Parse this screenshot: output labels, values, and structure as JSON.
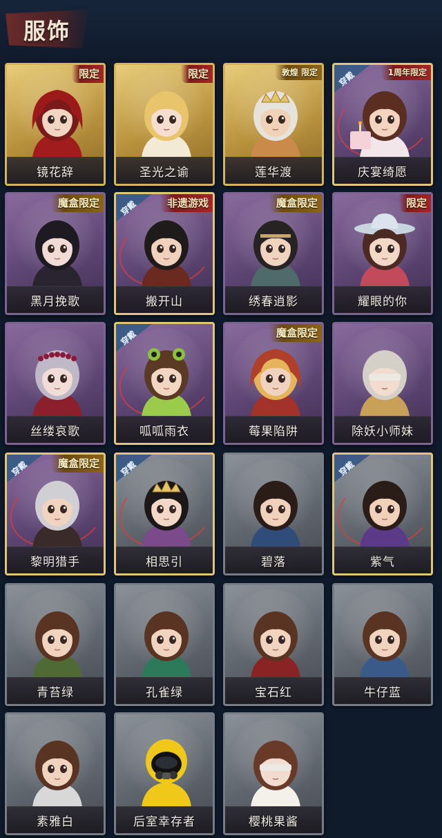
{
  "header": {
    "title": "服饰"
  },
  "costumes": [
    {
      "name": "镜花辞",
      "tag": "限定",
      "tag_style": "red",
      "frame": "gold",
      "worn": false,
      "hair": "#7a1a1a",
      "outfit": "#a11d1d",
      "skin": "#f2d6c4",
      "hat": "hood"
    },
    {
      "name": "圣光之谕",
      "tag": "限定",
      "tag_style": "red",
      "frame": "gold",
      "worn": false,
      "hair": "#e8c56a",
      "outfit": "#f3ead6",
      "skin": "#f5ddd0",
      "hat": "none"
    },
    {
      "name": "莲华渡",
      "tag": "敦煌 限定",
      "tag_style": "box",
      "frame": "gold",
      "worn": false,
      "hair": "#e6e2dc",
      "outfit": "#c98a4a",
      "skin": "#f0d2b8",
      "hat": "crown"
    },
    {
      "name": "庆宴绮愿",
      "tag": "1周年限定",
      "tag_style": "red",
      "frame": "purple",
      "worn": true,
      "hair": "#5a2f22",
      "outfit": "#f2e6ea",
      "skin": "#f2d4c0",
      "hat": "cake"
    },
    {
      "name": "黑月挽歌",
      "tag": "魔盒限定",
      "tag_style": "box",
      "frame": "purple",
      "worn": false,
      "hair": "#1e1a22",
      "outfit": "#2a2330",
      "skin": "#f0dcd4",
      "hat": "none"
    },
    {
      "name": "搬开山",
      "tag": "非遗游戏",
      "tag_style": "red",
      "frame": "purple",
      "worn": true,
      "hair": "#1f1b1b",
      "outfit": "#6a2a20",
      "skin": "#f0d2bc",
      "hat": "none"
    },
    {
      "name": "绣春逍影",
      "tag": "魔盒限定",
      "tag_style": "box",
      "frame": "purple",
      "worn": false,
      "hair": "#262322",
      "outfit": "#4f6a6a",
      "skin": "#efd4c0",
      "hat": "band"
    },
    {
      "name": "耀眼的你",
      "tag": "限定",
      "tag_style": "red",
      "frame": "purple",
      "worn": false,
      "hair": "#4a2a22",
      "outfit": "#c24a5a",
      "skin": "#f3d8c8",
      "hat": "cowboy"
    },
    {
      "name": "丝缕哀歌",
      "tag": "",
      "tag_style": "",
      "frame": "purple",
      "worn": false,
      "hair": "#bfb8c6",
      "outfit": "#8c1f2c",
      "skin": "#f2dcd8",
      "hat": "roses"
    },
    {
      "name": "呱呱雨衣",
      "tag": "",
      "tag_style": "",
      "frame": "purple",
      "worn": true,
      "hair": "#5a3a24",
      "outfit": "#9acb4a",
      "skin": "#f1d6c2",
      "hat": "frog"
    },
    {
      "name": "莓果陷阱",
      "tag": "魔盒限定",
      "tag_style": "box",
      "frame": "purple",
      "worn": false,
      "hair": "#e6b45a",
      "outfit": "#a2322a",
      "skin": "#f0d2c0",
      "hat": "hood-red"
    },
    {
      "name": "除妖小师妹",
      "tag": "",
      "tag_style": "",
      "frame": "purple",
      "worn": false,
      "hair": "#d4d0c8",
      "outfit": "#c8a058",
      "skin": "#f2dcd0",
      "hat": "blindfold"
    },
    {
      "name": "黎明猎手",
      "tag": "魔盒限定",
      "tag_style": "box",
      "frame": "purple",
      "worn": true,
      "hair": "#cfcfd4",
      "outfit": "#3a2a2a",
      "skin": "#f0d4c0",
      "hat": "none"
    },
    {
      "name": "相思引",
      "tag": "",
      "tag_style": "",
      "frame": "gray",
      "worn": true,
      "hair": "#1c1818",
      "outfit": "#7a4a8a",
      "skin": "#f2d8c6",
      "hat": "crown"
    },
    {
      "name": "碧落",
      "tag": "",
      "tag_style": "",
      "frame": "gray",
      "worn": false,
      "hair": "#2a1d18",
      "outfit": "#2f4c7a",
      "skin": "#f0d2bc",
      "hat": "none"
    },
    {
      "name": "紫气",
      "tag": "",
      "tag_style": "",
      "frame": "gray",
      "worn": true,
      "hair": "#2a1d18",
      "outfit": "#5b3a8a",
      "skin": "#f0d2bc",
      "hat": "none"
    },
    {
      "name": "青苔绿",
      "tag": "",
      "tag_style": "",
      "frame": "gray",
      "worn": false,
      "hair": "#5a3422",
      "outfit": "#4f6a34",
      "skin": "#f1d4c0",
      "hat": "none"
    },
    {
      "name": "孔雀绿",
      "tag": "",
      "tag_style": "",
      "frame": "gray",
      "worn": false,
      "hair": "#5a3422",
      "outfit": "#2d7a5a",
      "skin": "#f1d4c0",
      "hat": "none"
    },
    {
      "name": "宝石红",
      "tag": "",
      "tag_style": "",
      "frame": "gray",
      "worn": false,
      "hair": "#5a3422",
      "outfit": "#8a2424",
      "skin": "#f1d4c0",
      "hat": "none"
    },
    {
      "name": "牛仔蓝",
      "tag": "",
      "tag_style": "",
      "frame": "gray",
      "worn": false,
      "hair": "#5a3422",
      "outfit": "#3a5a8a",
      "skin": "#f1d4c0",
      "hat": "none"
    },
    {
      "name": "素雅白",
      "tag": "",
      "tag_style": "",
      "frame": "gray",
      "worn": false,
      "hair": "#5a3422",
      "outfit": "#d8d8d8",
      "skin": "#f1d4c0",
      "hat": "none"
    },
    {
      "name": "后室幸存者",
      "tag": "",
      "tag_style": "",
      "frame": "gray",
      "worn": false,
      "hair": "#f0c81a",
      "outfit": "#f0c81a",
      "skin": "#1a1a1a",
      "hat": "gasmask"
    },
    {
      "name": "樱桃果酱",
      "tag": "",
      "tag_style": "",
      "frame": "gray",
      "worn": false,
      "hair": "#6a3a28",
      "outfit": "#f4f0ea",
      "skin": "#f2dcd0",
      "hat": "blindfold"
    }
  ],
  "worn_label": "穿戴"
}
